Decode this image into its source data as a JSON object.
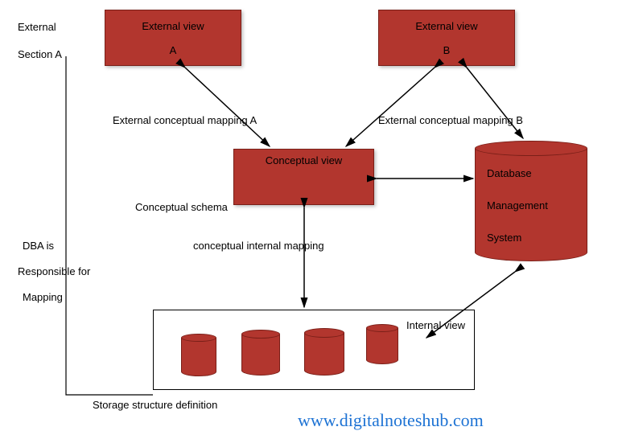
{
  "boxes": {
    "external_a": {
      "title": "External view",
      "sub": "A"
    },
    "external_b": {
      "title": "External view",
      "sub": "B"
    },
    "conceptual": {
      "title": "Conceptual view"
    }
  },
  "labels": {
    "external": "External",
    "section_a": "Section A",
    "mapping_a": "External conceptual mapping A",
    "mapping_b": "External conceptual mapping B",
    "conceptual_schema": "Conceptual schema",
    "conceptual_internal": "conceptual internal mapping",
    "dba_line1": "DBA is",
    "dba_line2": "Responsible for",
    "dba_line3": "Mapping",
    "internal_view": "Internal view",
    "storage_def": "Storage structure definition"
  },
  "dbms": {
    "line1": "Database",
    "line2": "Management",
    "line3": "System"
  },
  "watermark": "www.digitalnoteshub.com",
  "colors": {
    "fill": "#b2362e",
    "link": "#1e73d4"
  }
}
